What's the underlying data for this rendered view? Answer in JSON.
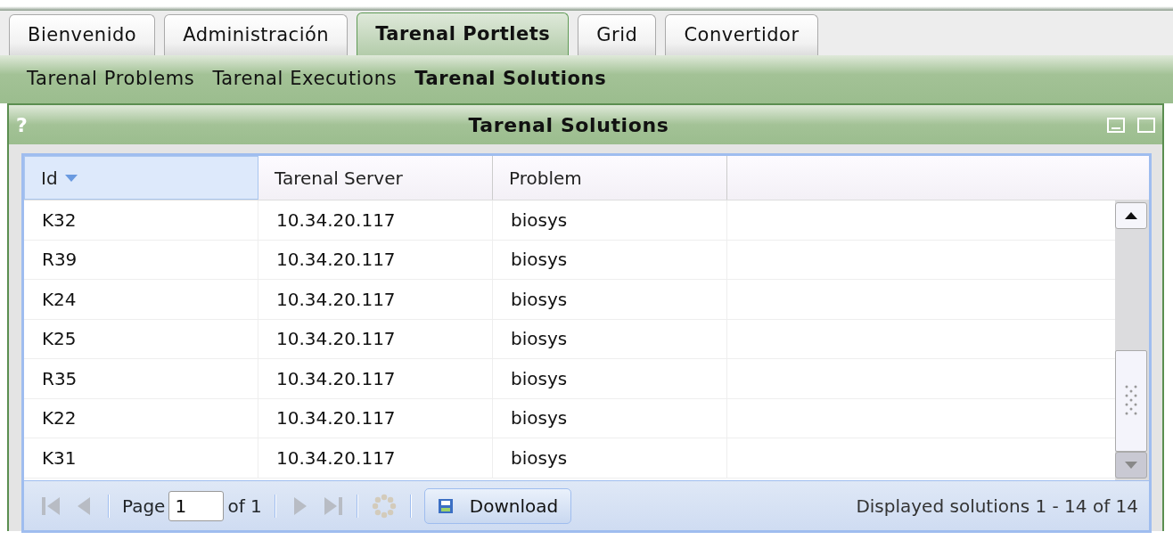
{
  "tabs": [
    {
      "label": "Bienvenido",
      "selected": false
    },
    {
      "label": "Administración",
      "selected": false
    },
    {
      "label": "Tarenal Portlets",
      "selected": true
    },
    {
      "label": "Grid",
      "selected": false
    },
    {
      "label": "Convertidor",
      "selected": false
    }
  ],
  "subnav": [
    {
      "label": "Tarenal Problems",
      "selected": false
    },
    {
      "label": "Tarenal Executions",
      "selected": false
    },
    {
      "label": "Tarenal Solutions",
      "selected": true
    }
  ],
  "portlet": {
    "help": "?",
    "title": "Tarenal Solutions"
  },
  "table": {
    "columns": [
      {
        "label": "Id",
        "sorted": true
      },
      {
        "label": "Tarenal Server",
        "sorted": false
      },
      {
        "label": "Problem",
        "sorted": false
      }
    ],
    "rows": [
      [
        "K32",
        "10.34.20.117",
        "biosys"
      ],
      [
        "R39",
        "10.34.20.117",
        "biosys"
      ],
      [
        "K24",
        "10.34.20.117",
        "biosys"
      ],
      [
        "K25",
        "10.34.20.117",
        "biosys"
      ],
      [
        "R35",
        "10.34.20.117",
        "biosys"
      ],
      [
        "K22",
        "10.34.20.117",
        "biosys"
      ],
      [
        "K31",
        "10.34.20.117",
        "biosys"
      ]
    ]
  },
  "toolbar": {
    "nav_before": [
      {
        "kind": "first",
        "disabled": true
      },
      {
        "kind": "prev",
        "disabled": true
      }
    ],
    "page_label": "Page",
    "page": "1",
    "of_label": "of 1",
    "nav_after": [
      {
        "kind": "next",
        "disabled": true
      },
      {
        "kind": "last",
        "disabled": true
      }
    ],
    "download": "Download",
    "status": "Displayed solutions 1 - 14 of 14"
  }
}
